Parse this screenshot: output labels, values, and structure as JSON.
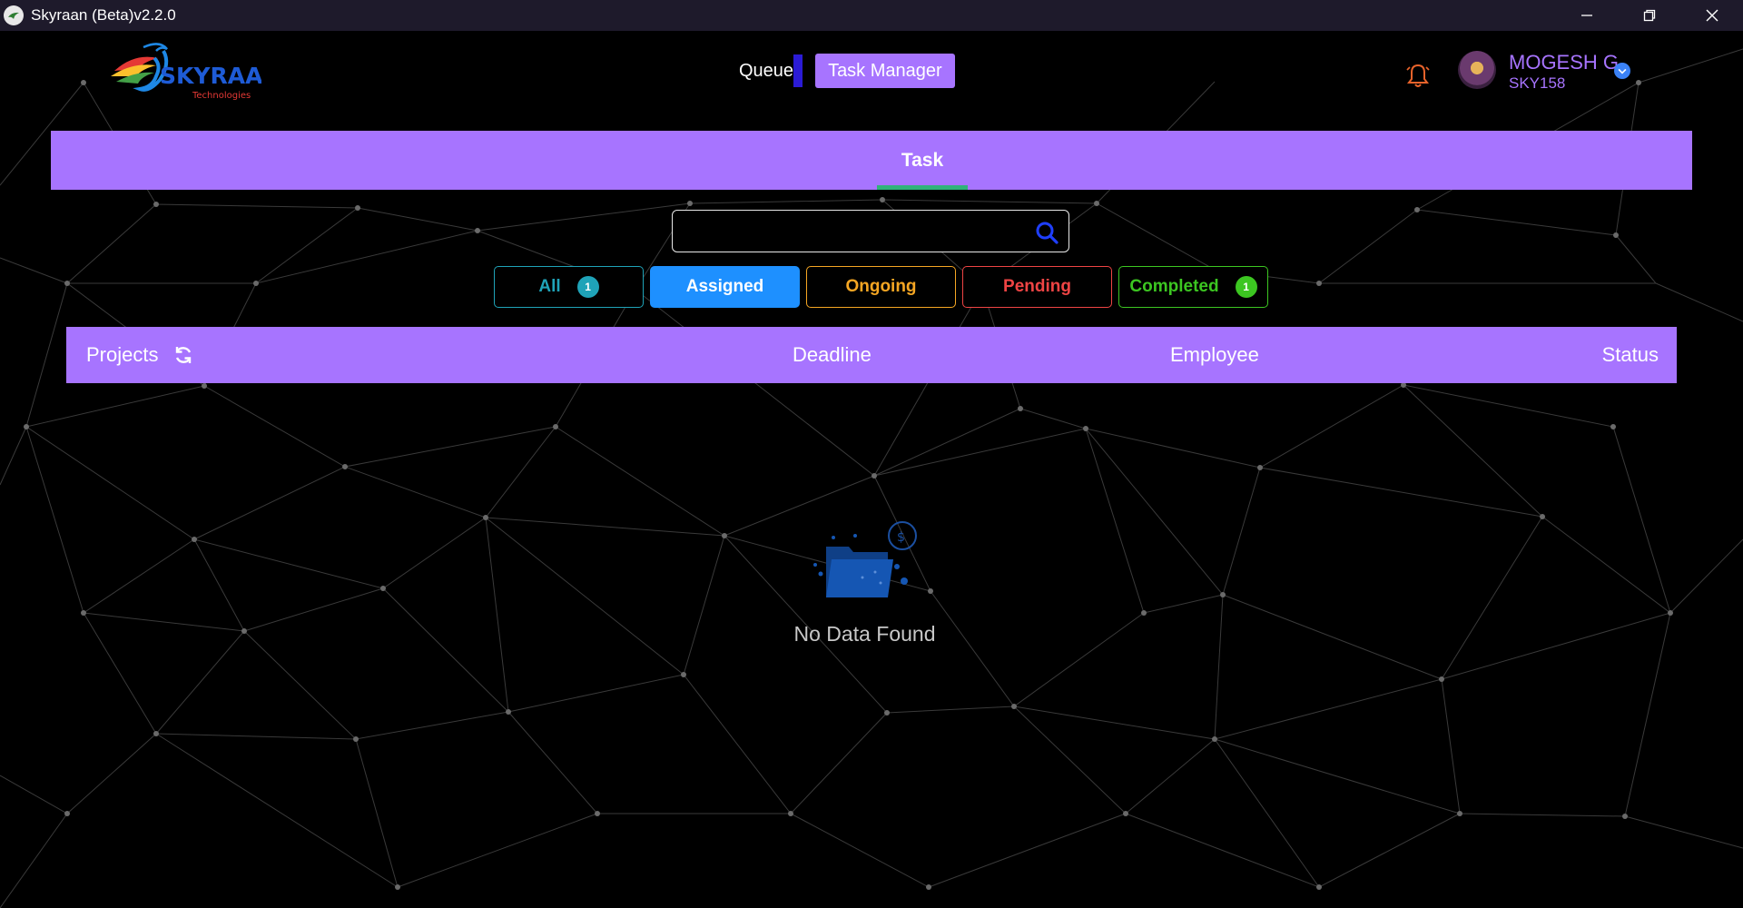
{
  "window": {
    "title": "Skyraan (Beta)v2.2.0",
    "controls": [
      "minimize-icon",
      "restore-icon",
      "close-icon"
    ]
  },
  "header": {
    "logo_text": "SKYRAAN",
    "logo_subtext": "Technologies",
    "nav": {
      "queue_label": "Queue",
      "task_manager_label": "Task Manager"
    },
    "user": {
      "name": "MOGESH G",
      "id": "SKY158"
    },
    "icons": [
      "bell-icon",
      "avatar",
      "verified-icon"
    ]
  },
  "task_banner": {
    "tab_label": "Task"
  },
  "search": {
    "value": "",
    "placeholder": ""
  },
  "filters": [
    {
      "label": "All",
      "badge": "1",
      "color": "#1fa3b8"
    },
    {
      "label": "Assigned",
      "badge": "",
      "color": "#1e90ff"
    },
    {
      "label": "Ongoing",
      "badge": "",
      "color": "#f5a623"
    },
    {
      "label": "Pending",
      "badge": "",
      "color": "#ef4444"
    },
    {
      "label": "Completed",
      "badge": "1",
      "color": "#3cc621"
    }
  ],
  "table": {
    "columns": {
      "projects": "Projects",
      "deadline": "Deadline",
      "employee": "Employee",
      "status": "Status"
    },
    "rows": []
  },
  "empty_state": {
    "message": "No Data Found"
  },
  "colors": {
    "accent": "#a774ff",
    "background": "#000000",
    "titlebar": "#1e1a2b"
  }
}
